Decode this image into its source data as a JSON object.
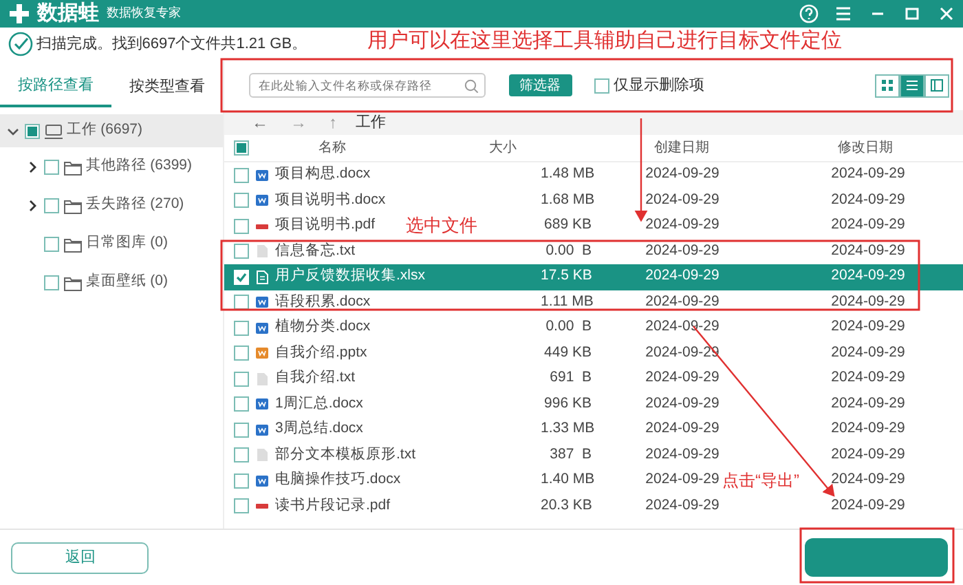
{
  "app": {
    "name": "数据蛙",
    "subtitle": "数据恢复专家"
  },
  "status": {
    "text": "扫描完成。找到6697个文件共1.21 GB。"
  },
  "view_tabs": [
    {
      "label": "按路径查看",
      "selected": true
    },
    {
      "label": "按类型查看",
      "selected": false
    }
  ],
  "tree": [
    {
      "label": "工作 (6697)",
      "kind": "drive",
      "selected": true,
      "expanded": true,
      "partial": true,
      "children": [
        {
          "label": "其他路径 (6399)",
          "kind": "folder",
          "selected": false,
          "expanded": false,
          "partial": false
        },
        {
          "label": "丢失路径 (270)",
          "kind": "folder",
          "selected": false,
          "expanded": false,
          "partial": false
        },
        {
          "label": "日常图库 (0)",
          "kind": "folder",
          "selected": false,
          "partial": false
        },
        {
          "label": "桌面壁纸 (0)",
          "kind": "folder",
          "selected": false,
          "partial": false
        }
      ]
    }
  ],
  "toolbar": {
    "search": {
      "placeholder": "在此处输入文件名称或保存路径"
    },
    "filter_button": "筛选器",
    "deleted_only": {
      "label": "仅显示删除项",
      "checked": false
    },
    "view_modes": [
      {
        "kind": "grid",
        "selected": false
      },
      {
        "kind": "list",
        "selected": true
      },
      {
        "kind": "preview",
        "selected": false
      }
    ]
  },
  "nav": {
    "back": {
      "label": "←",
      "disabled": false
    },
    "forward": {
      "label": "→",
      "disabled": true
    },
    "up": {
      "label": "↑",
      "disabled": true
    },
    "path": "工作"
  },
  "table": {
    "select_all_partial": true,
    "columns": [
      "名称",
      "大小",
      "创建日期",
      "修改日期"
    ],
    "rows": [
      {
        "kind": "docx",
        "name": "项目构思.docx",
        "size": "1.48 MB",
        "created": "2024-09-29",
        "modified": "2024-09-29",
        "selected": false
      },
      {
        "kind": "docx",
        "name": "项目说明书.docx",
        "size": "1.68 MB",
        "created": "2024-09-29",
        "modified": "2024-09-29",
        "selected": false
      },
      {
        "kind": "pdf",
        "name": "项目说明书.pdf",
        "size": "689 KB",
        "created": "2024-09-29",
        "modified": "2024-09-29",
        "selected": false
      },
      {
        "kind": "txt",
        "name": "信息备忘.txt",
        "size": "0.00  B",
        "created": "2024-09-29",
        "modified": "2024-09-29",
        "selected": false
      },
      {
        "kind": "xlsx",
        "name": "用户反馈数据收集.xlsx",
        "size": "17.5 KB",
        "created": "2024-09-29",
        "modified": "2024-09-29",
        "selected": true
      },
      {
        "kind": "docx",
        "name": "语段积累.docx",
        "size": "1.11 MB",
        "created": "2024-09-29",
        "modified": "2024-09-29",
        "selected": false
      },
      {
        "kind": "docx",
        "name": "植物分类.docx",
        "size": "0.00  B",
        "created": "2024-09-29",
        "modified": "2024-09-29",
        "selected": false
      },
      {
        "kind": "pptx",
        "name": "自我介绍.pptx",
        "size": "449 KB",
        "created": "2024-09-29",
        "modified": "2024-09-29",
        "selected": false
      },
      {
        "kind": "txt",
        "name": "自我介绍.txt",
        "size": "691  B",
        "created": "2024-09-29",
        "modified": "2024-09-29",
        "selected": false
      },
      {
        "kind": "docx",
        "name": "1周汇总.docx",
        "size": "996 KB",
        "created": "2024-09-29",
        "modified": "2024-09-29",
        "selected": false
      },
      {
        "kind": "docx",
        "name": "3周总结.docx",
        "size": "1.33 MB",
        "created": "2024-09-29",
        "modified": "2024-09-29",
        "selected": false
      },
      {
        "kind": "txt",
        "name": "部分文本模板原形.txt",
        "size": "387  B",
        "created": "2024-09-29",
        "modified": "2024-09-29",
        "selected": false
      },
      {
        "kind": "docx",
        "name": "电脑操作技巧.docx",
        "size": "1.40 MB",
        "created": "2024-09-29",
        "modified": "2024-09-29",
        "selected": false
      },
      {
        "kind": "pdf",
        "name": "读书片段记录.pdf",
        "size": "20.3 KB",
        "created": "2024-09-29",
        "modified": "2024-09-29",
        "selected": false
      }
    ]
  },
  "footer": {
    "back_button": "返回"
  },
  "annotations": [
    {
      "kind": "callout",
      "text": "用户可以在这里选择工具辅助自己进行目标文件定位"
    },
    {
      "kind": "callout",
      "text": "选中文件"
    },
    {
      "kind": "callout",
      "text": "点击“导出”"
    }
  ]
}
